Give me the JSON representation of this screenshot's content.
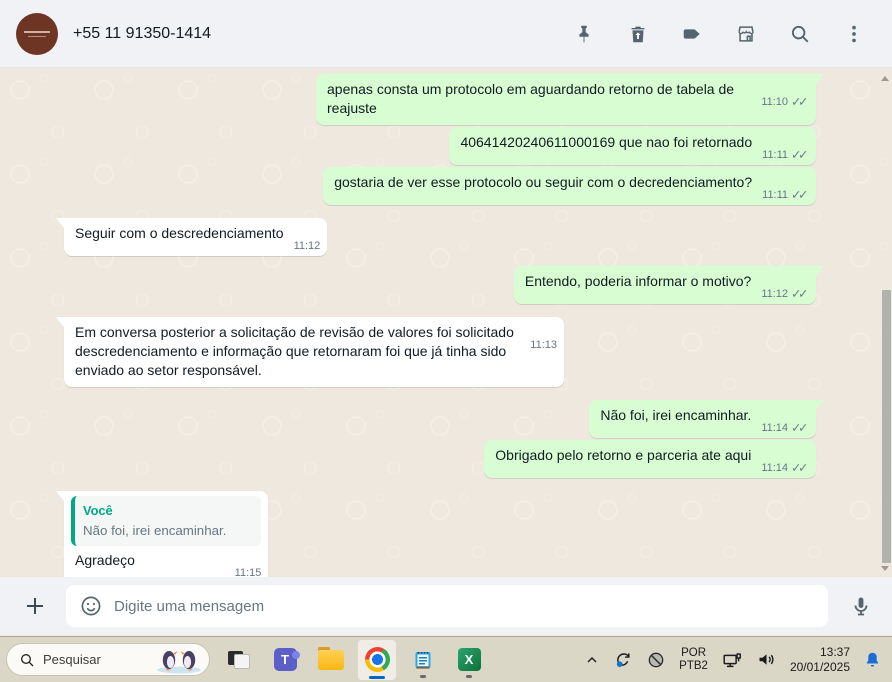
{
  "header": {
    "contact_name": "+55 11 91350-1414"
  },
  "icons": {
    "double_check": "✓✓",
    "teams_logo_letter": "T",
    "excel_logo_letter": "X"
  },
  "messages": [
    {
      "direction": "out",
      "text": "apenas consta um protocolo em aguardando retorno de tabela de reajuste",
      "time": "11:10",
      "status": "delivered"
    },
    {
      "direction": "out",
      "text": "40641420240611000169 que nao foi retornado",
      "time": "11:11",
      "status": "delivered"
    },
    {
      "direction": "out",
      "text": "gostaria de ver esse protocolo ou seguir com o decredenciamento?",
      "time": "11:11",
      "status": "delivered"
    },
    {
      "direction": "in",
      "text": "Seguir com o descredenciamento",
      "time": "11:12"
    },
    {
      "direction": "out",
      "text": "Entendo, poderia informar o motivo?",
      "time": "11:12",
      "status": "delivered"
    },
    {
      "direction": "in",
      "text": "Em conversa posterior a solicitação de revisão de valores foi solicitado descredenciamento e informação que retornaram foi que já tinha sido enviado ao setor responsável.",
      "time": "11:13"
    },
    {
      "direction": "out",
      "text": "Não foi, irei encaminhar.",
      "time": "11:14",
      "status": "delivered"
    },
    {
      "direction": "out",
      "text": "Obrigado pelo retorno e parceria ate aqui",
      "time": "11:14",
      "status": "delivered"
    },
    {
      "direction": "in",
      "quote": {
        "author": "Você",
        "text": "Não foi, irei encaminhar."
      },
      "text": "Agradeço",
      "time": "11:15"
    }
  ],
  "composer": {
    "placeholder": "Digite uma mensagem"
  },
  "taskbar": {
    "search_placeholder": "Pesquisar",
    "language": {
      "line1": "POR",
      "line2": "PTB2"
    },
    "clock": {
      "time": "13:37",
      "date": "20/01/2025"
    }
  },
  "colors": {
    "outgoing_bubble": "#d9fdd3",
    "incoming_bubble": "#ffffff",
    "chat_background": "#efe8de",
    "header_background": "#f0f2f5",
    "quote_accent": "#00a884",
    "taskbar_background": "#dbd7c7",
    "bell_blue": "#1a6dd3"
  }
}
